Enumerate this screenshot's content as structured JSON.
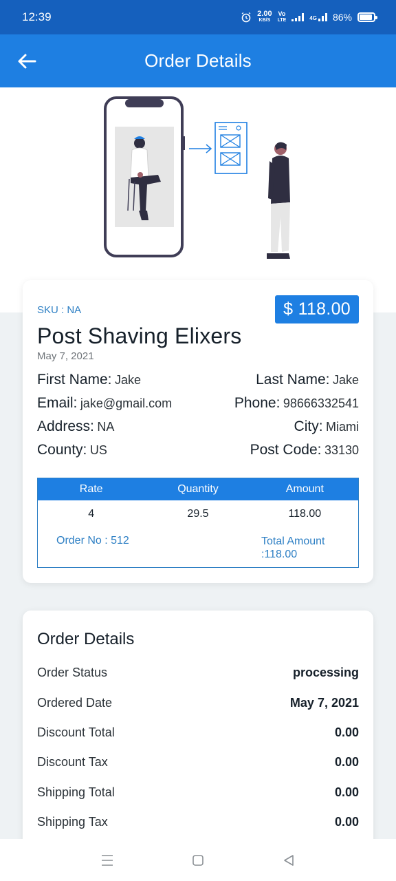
{
  "status_bar": {
    "time": "12:39",
    "net_speed_top": "2.00",
    "net_speed_bottom": "KB/S",
    "volte_top": "Vo",
    "volte_bottom": "LTE",
    "network_label": "4G",
    "battery": "86%"
  },
  "app_bar": {
    "title": "Order Details"
  },
  "product": {
    "sku": "SKU : NA",
    "price": "$ 118.00",
    "name": "Post Shaving Elixers",
    "date": "May 7, 2021"
  },
  "customer": {
    "first_name_label": "First Name:",
    "first_name": "Jake",
    "last_name_label": "Last Name:",
    "last_name": "Jake",
    "email_label": "Email:",
    "email": "jake@gmail.com",
    "phone_label": "Phone:",
    "phone": "98666332541",
    "address_label": "Address:",
    "address": "NA",
    "city_label": "City:",
    "city": "Miami",
    "county_label": "County:",
    "county": "US",
    "post_code_label": "Post Code:",
    "post_code": "33130"
  },
  "order_table": {
    "headers": [
      "Rate",
      "Quantity",
      "Amount"
    ],
    "row": [
      "4",
      "29.5",
      "118.00"
    ],
    "order_no": "Order No : 512",
    "total_amount": "Total Amount :118.00"
  },
  "order_details": {
    "title": "Order Details",
    "rows": [
      {
        "label": "Order Status",
        "value": "processing"
      },
      {
        "label": "Ordered Date",
        "value": "May 7, 2021"
      },
      {
        "label": "Discount Total",
        "value": "0.00"
      },
      {
        "label": "Discount Tax",
        "value": "0.00"
      },
      {
        "label": "Shipping Total",
        "value": "0.00"
      },
      {
        "label": "Shipping Tax",
        "value": "0.00"
      }
    ]
  },
  "colors": {
    "status_bar": "#1560bd",
    "app_bar": "#1e7fe2",
    "accent_text": "#2d7fc4",
    "background": "#eef2f4"
  },
  "icons": {
    "back": "arrow-left-icon",
    "alarm": "alarm-icon",
    "signal": "signal-bars-icon",
    "battery": "battery-icon",
    "nav_menu": "menu-lines-icon",
    "nav_home": "square-home-icon",
    "nav_back": "triangle-back-icon"
  }
}
